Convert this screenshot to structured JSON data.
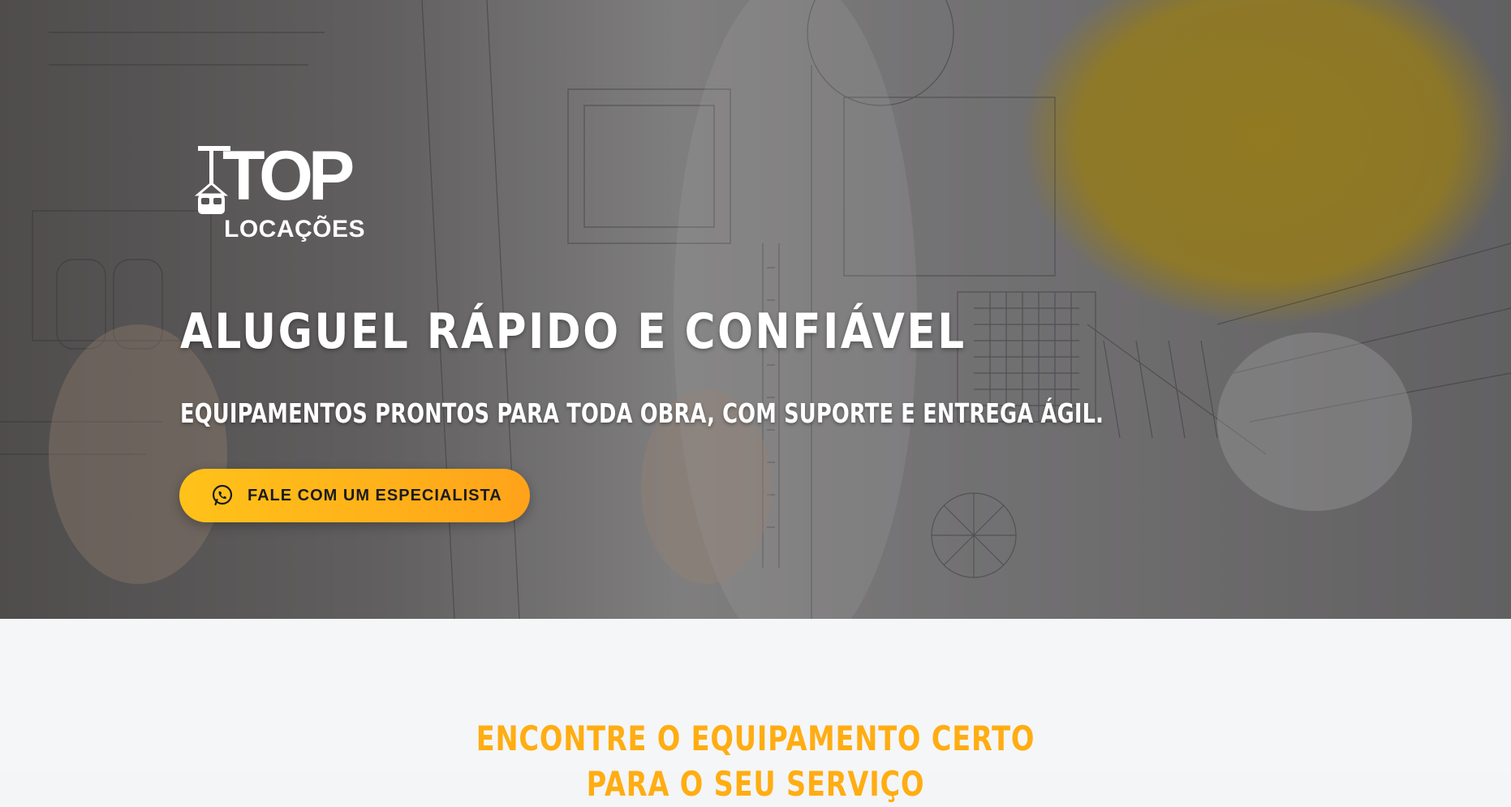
{
  "hero": {
    "logo": {
      "name": "TOP",
      "subname": "LOCAÇÕES"
    },
    "title": "ALUGUEL RÁPIDO E CONFIÁVEL",
    "subtitle": "EQUIPAMENTOS PRONTOS PARA TODA OBRA, COM SUPORTE E ENTREGA ÁGIL.",
    "cta": {
      "label": "FALE COM UM ESPECIALISTA",
      "icon": "whatsapp-icon"
    }
  },
  "section": {
    "title": "ENCONTRE O EQUIPAMENTO CERTO PARA O SEU SERVIÇO"
  },
  "colors": {
    "accent": "#ffb21a",
    "section_title": "#ffad12",
    "hero_text": "#ffffff",
    "cta_text": "#1b1b1b"
  }
}
